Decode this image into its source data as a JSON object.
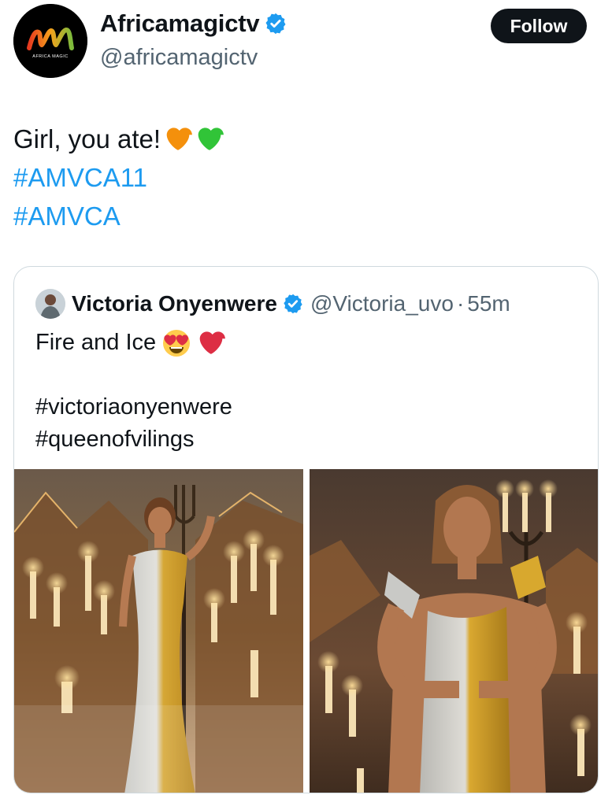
{
  "author": {
    "display_name": "Africamagictv",
    "handle": "@africamagictv",
    "avatar_text": "AFRICA MAGIC",
    "verified": true
  },
  "follow_button": {
    "label": "Follow"
  },
  "tweet": {
    "lines": [
      "Girl, you ate!",
      "#AMVCA11",
      "#AMVCA"
    ],
    "emojis": [
      "orange-heart",
      "green-heart"
    ]
  },
  "quoted_tweet": {
    "display_name": "Victoria Onyenwere",
    "handle": "@Victoria_uvo",
    "separator": "·",
    "time": "55m",
    "verified": true,
    "text_lines": [
      "Fire and Ice",
      "",
      "#victoriaonyenwere",
      "#queenofvilings"
    ],
    "emojis": [
      "heart-eyes-face",
      "red-heart"
    ]
  },
  "colors": {
    "accent": "#1d9bf0",
    "text": "#0f1419",
    "secondary_text": "#536471",
    "border": "#cfd9de",
    "follow_bg": "#0f1419"
  }
}
